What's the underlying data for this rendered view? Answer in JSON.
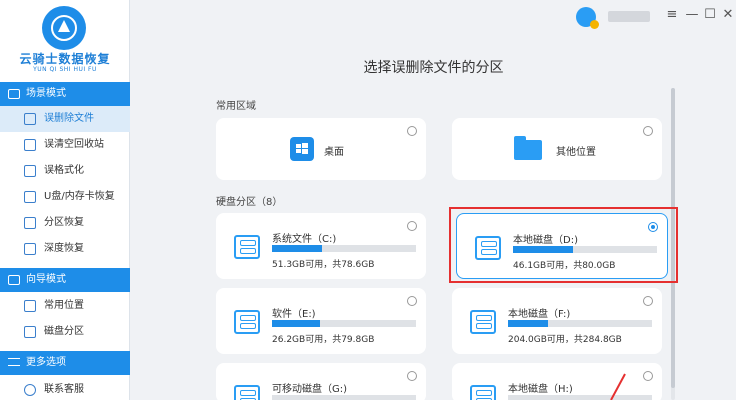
{
  "app": {
    "logo_title": "云骑士数据恢复",
    "logo_subtitle": "YUN QI SHI HUI FU"
  },
  "sidebar": {
    "sections": [
      {
        "label": "场景模式",
        "items": [
          {
            "label": "误删除文件",
            "active": true,
            "icon": "file-delete-icon"
          },
          {
            "label": "误清空回收站",
            "icon": "recycle-bin-icon"
          },
          {
            "label": "误格式化",
            "icon": "format-icon"
          },
          {
            "label": "U盘/内存卡恢复",
            "icon": "usb-icon"
          },
          {
            "label": "分区恢复",
            "icon": "partition-icon"
          },
          {
            "label": "深度恢复",
            "icon": "deep-scan-icon"
          }
        ]
      },
      {
        "label": "向导模式",
        "items": [
          {
            "label": "常用位置",
            "icon": "common-location-icon"
          },
          {
            "label": "磁盘分区",
            "icon": "disk-partition-icon"
          }
        ]
      },
      {
        "label": "更多选项",
        "items": [
          {
            "label": "联系客服",
            "icon": "customer-service-icon"
          }
        ]
      }
    ]
  },
  "window_controls": {
    "menu": "≡",
    "minimize": "—",
    "maximize": "☐",
    "close": "✕"
  },
  "main": {
    "title": "选择误删除文件的分区",
    "common_area": {
      "label": "常用区域",
      "cards": [
        {
          "label": "桌面",
          "icon": "desktop-icon"
        },
        {
          "label": "其他位置",
          "icon": "folder-icon"
        }
      ]
    },
    "disks_group": {
      "label": "硬盘分区（8）",
      "disks": [
        {
          "name": "系统文件（C:)",
          "size": "51.3GB可用，共78.6GB",
          "used_fraction": 0.35,
          "selected": false
        },
        {
          "name": "本地磁盘（D:)",
          "size": "46.1GB可用，共80.0GB",
          "used_fraction": 0.42,
          "selected": true
        },
        {
          "name": "软件（E:)",
          "size": "26.2GB可用，共79.8GB",
          "used_fraction": 0.33,
          "selected": false
        },
        {
          "name": "本地磁盘（F:)",
          "size": "204.0GB可用，共284.8GB",
          "used_fraction": 0.28,
          "selected": false
        },
        {
          "name": "可移动磁盘（G:)",
          "size": "",
          "used_fraction": 0,
          "selected": false
        },
        {
          "name": "本地磁盘（H:)",
          "size": "",
          "used_fraction": 0,
          "selected": false
        }
      ]
    }
  },
  "colors": {
    "accent": "#1e8de8",
    "highlight": "#e53030"
  }
}
